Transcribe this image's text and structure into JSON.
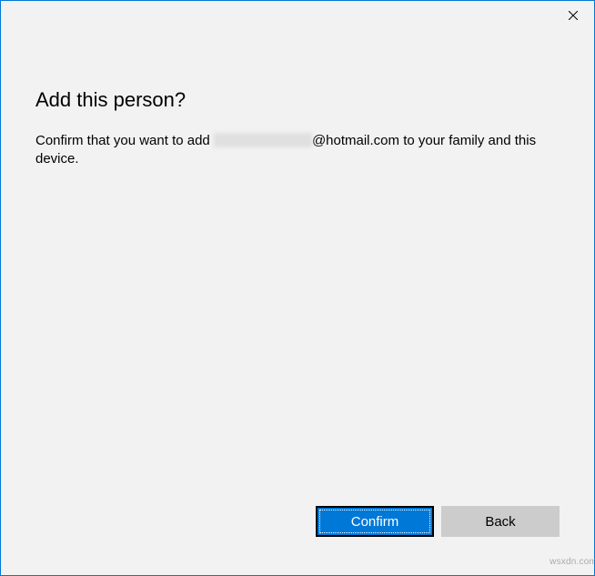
{
  "titlebar": {
    "close_icon": "close"
  },
  "dialog": {
    "heading": "Add this person?",
    "body_prefix": "Confirm that you want to add ",
    "body_email_suffix": "@hotmail.com to your family and this device."
  },
  "buttons": {
    "confirm": "Confirm",
    "back": "Back"
  },
  "watermark": "wsxdn.com"
}
